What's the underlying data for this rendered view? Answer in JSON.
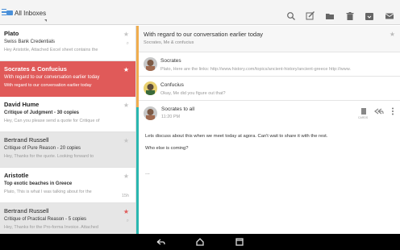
{
  "topbar": {
    "title": "All Inboxes",
    "icons": [
      "search-icon",
      "compose-icon",
      "folder-icon",
      "delete-icon",
      "archive-icon",
      "mail-icon"
    ]
  },
  "inbox": [
    {
      "sender": "Plato",
      "subject": "Swiss Bank Credentials",
      "snippet": "Hey Aristotle, Attached Excel sheet contains the",
      "meta": "",
      "starred": false,
      "state": "normal",
      "attachment": true
    },
    {
      "sender": "Socrates & Confucius",
      "subject": "With regard to our conversation earlier today",
      "snippet": "With regard to our conversation earlier today",
      "meta": "",
      "starred": false,
      "state": "selected",
      "attachment": false
    },
    {
      "sender": "David Hume",
      "subject": "Critique of Judgment - 30 copies",
      "snippet": "Hey, Can you please send a quote for Critique of",
      "meta": "",
      "starred": false,
      "state": "unread",
      "attachment": false
    },
    {
      "sender": "Bertrand Russell",
      "subject": "Critique of Pure Reason - 20 copies",
      "snippet": "Hey, Thanks for the quote. Looking forward to",
      "meta": "",
      "starred": false,
      "state": "read",
      "attachment": false
    },
    {
      "sender": "Aristotle",
      "subject": "Top exotic beaches in Greece",
      "snippet": "Plato, This is what I was talking about for the",
      "meta": "15h",
      "starred": false,
      "state": "unread",
      "attachment": false
    },
    {
      "sender": "Bertrand Russell",
      "subject": "Critique of Practical Reason - 5 copies",
      "snippet": "Hey, Thanks for the Pro-forma Invoice. Attached",
      "meta": "",
      "starred": true,
      "state": "read",
      "attachment": true
    }
  ],
  "conversation": {
    "subject": "With regard to our conversation earlier today",
    "participants": "Socrates, Me & confucius",
    "messages": [
      {
        "from": "Socrates",
        "preview": "Plato, Here are the links: http://www.history.com/topics/ancient-history/ancient-greece http://www."
      },
      {
        "from": "Confucius",
        "preview": "Okay, Me did you figure out that?"
      }
    ],
    "open_message": {
      "from": "Socrates to all",
      "time": "11:20 PM",
      "body": [
        "Lets discuss about this when we meet today at agora. Can't wait to share it with the rest.",
        "Who else is coming?"
      ],
      "more": "...",
      "action_label": "CARDS"
    }
  },
  "colors": {
    "accent_red": "#e05a59",
    "strip_orange": "#f0ad4e",
    "strip_teal": "#2ab7b0",
    "link_blue": "#4a90d9"
  },
  "navbar": {
    "icons": [
      "back-icon",
      "home-icon",
      "recents-icon"
    ]
  }
}
